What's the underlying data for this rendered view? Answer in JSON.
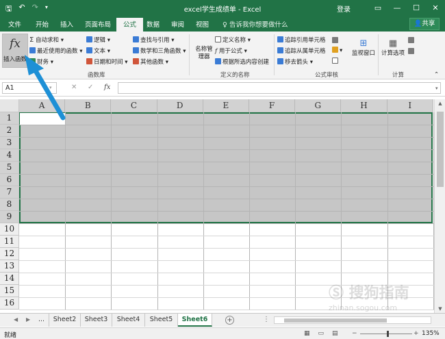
{
  "titlebar": {
    "title": "excel学生成绩单 - Excel",
    "login": "登录",
    "buttons": [
      "□",
      "—",
      "☐",
      "✕"
    ]
  },
  "tabs": [
    {
      "label": "文件"
    },
    {
      "label": "开始"
    },
    {
      "label": "插入"
    },
    {
      "label": "页面布局"
    },
    {
      "label": "公式"
    },
    {
      "label": "数据"
    },
    {
      "label": "审阅"
    },
    {
      "label": "视图"
    }
  ],
  "tellme": "告诉我你想要做什么",
  "share": "共享",
  "ribbon": {
    "insert_function": {
      "icon": "fx",
      "label": "插入函数"
    },
    "library": {
      "autosum": "自动求和",
      "recent": "最近使用的函数",
      "financial": "财务",
      "logical": "逻辑",
      "text": "文本",
      "datetime": "日期和时间",
      "lookup": "查找与引用",
      "math": "数学和三角函数",
      "other": "其他函数",
      "group_label": "函数库"
    },
    "names": {
      "manager": "名称管理器",
      "define": "定义名称",
      "use": "用于公式",
      "create": "根据所选内容创建",
      "group_label": "定义的名称"
    },
    "audit": {
      "trace_precedents": "追踪引用单元格",
      "trace_dependents": "追踪从属单元格",
      "remove_arrows": "移去箭头",
      "watch": "监视窗口",
      "group_label": "公式审核"
    },
    "calc": {
      "options": "计算选项",
      "group_label": "计算"
    }
  },
  "formula_bar": {
    "namebox": "A1",
    "cancel": "✕",
    "enter": "✓",
    "fx": "fx",
    "value": ""
  },
  "columns": [
    "A",
    "B",
    "C",
    "D",
    "E",
    "F",
    "G",
    "H",
    "I"
  ],
  "rows": [
    "1",
    "2",
    "3",
    "4",
    "5",
    "6",
    "7",
    "8",
    "9",
    "10",
    "11",
    "12",
    "13",
    "14",
    "15",
    "16"
  ],
  "selected_rows": 9,
  "sheets": {
    "ellipsis": "...",
    "tabs": [
      "Sheet2",
      "Sheet3",
      "Sheet4",
      "Sheet5",
      "Sheet6"
    ],
    "active": "Sheet6"
  },
  "status": {
    "ready": "就绪",
    "zoom": "135%"
  },
  "watermark": {
    "main": "搜狗指南",
    "sub": "zhinan.sogou.com"
  },
  "colors": {
    "accent": "#217346",
    "arrow": "#1e90d6"
  }
}
